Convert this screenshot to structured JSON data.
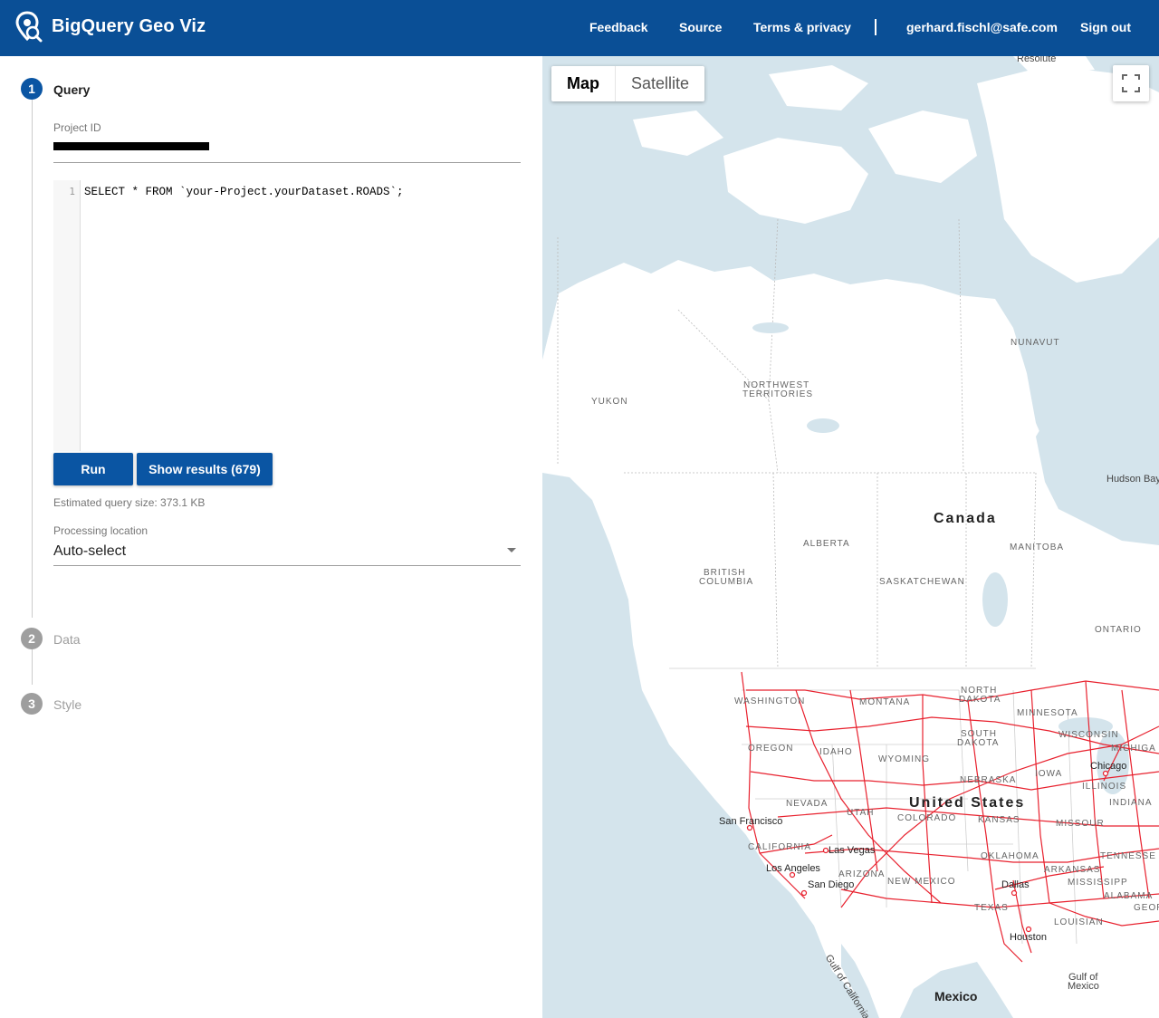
{
  "header": {
    "title": "BigQuery Geo Viz",
    "nav": {
      "feedback": "Feedback",
      "source": "Source",
      "terms": "Terms & privacy",
      "user": "gerhard.fischl@safe.com",
      "signout": "Sign out"
    }
  },
  "steps": [
    {
      "number": "1",
      "label": "Query"
    },
    {
      "number": "2",
      "label": "Data"
    },
    {
      "number": "3",
      "label": "Style"
    }
  ],
  "query": {
    "project_label": "Project ID",
    "editor_line_no": "1",
    "sql": "SELECT * FROM `your-Project.yourDataset.ROADS`;",
    "run_label": "Run",
    "show_results_label": "Show results (679)",
    "estimate": "Estimated query size: 373.1 KB",
    "location_label": "Processing location",
    "location_value": "Auto-select"
  },
  "map": {
    "tabs": {
      "map": "Map",
      "satellite": "Satellite"
    },
    "labels": {
      "resolute": "Resolute",
      "nunavut": "NUNAVUT",
      "yukon": "YUKON",
      "nwt1": "NORTHWEST",
      "nwt2": "TERRITORIES",
      "hudson": "Hudson Bay",
      "canada": "Canada",
      "alberta": "ALBERTA",
      "manitoba": "MANITOBA",
      "bc1": "BRITISH",
      "bc2": "COLUMBIA",
      "saskatchewan": "SASKATCHEWAN",
      "ontario": "ONTARIO",
      "washington": "WASHINGTON",
      "montana": "MONTANA",
      "north_dakota1": "NORTH",
      "north_dakota2": "DAKOTA",
      "minnesota": "MINNESOTA",
      "oregon": "OREGON",
      "idaho": "IDAHO",
      "wyoming": "WYOMING",
      "south_dakota1": "SOUTH",
      "south_dakota2": "DAKOTA",
      "wisconsin": "WISCONSIN",
      "michigan": "MICHIGA",
      "chicago": "Chicago",
      "nebraska": "NEBRASKA",
      "iowa": "IOWA",
      "illinois": "ILLINOIS",
      "indiana": "INDIANA",
      "nevada": "NEVADA",
      "utah": "UTAH",
      "united_states": "United States",
      "colorado": "COLORADO",
      "kansas": "KANSAS",
      "missouri": "MISSOUR",
      "san_francisco": "San Francisco",
      "california": "CALIFORNIA",
      "las_vegas": "Las Vegas",
      "oklahoma": "OKLAHOMA",
      "tennessee": "TENNESSE",
      "los_angeles": "Los Angeles",
      "arizona": "ARIZONA",
      "arkansas": "ARKANSAS",
      "san_diego": "San Diego",
      "new_mexico": "NEW MEXICO",
      "dallas": "Dallas",
      "mississippi": "MISSISSIPP",
      "alabama": "ALABAMA",
      "georgia": "GEOR",
      "texas": "TEXAS",
      "louisiana": "LOUISIAN",
      "houston": "Houston",
      "gulf_california": "Gulf of California",
      "gulf_mexico1": "Gulf of",
      "gulf_mexico2": "Mexico",
      "mexico": "Mexico"
    }
  },
  "colors": {
    "header": "#0a4f96",
    "primary": "#0a55a3",
    "roads": "#e8212e",
    "water": "#d4e4ec",
    "land": "#ffffff"
  }
}
